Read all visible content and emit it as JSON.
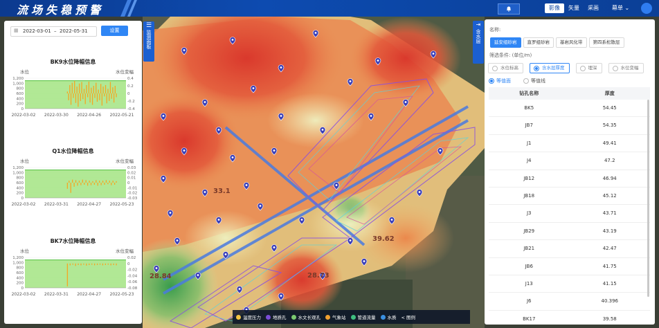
{
  "app": {
    "title": "流场失稳预警"
  },
  "header": {
    "bell_icon": "bell-icon",
    "map_types": [
      "影像",
      "矢量",
      "采画"
    ],
    "active_map_type": "影像",
    "menu_label": "幕单",
    "avatar_icon": "user-avatar-icon"
  },
  "left_panel": {
    "date_start": "2022-03-01",
    "date_sep": "–",
    "date_end": "2022-05-31",
    "set_button": "设置",
    "charts": [
      {
        "title": "BK9水位降幅信息",
        "left_label": "水位",
        "right_label": "水位变幅",
        "left_ticks": [
          "1,200",
          "1,000",
          "800",
          "600",
          "400",
          "200",
          "0"
        ],
        "right_ticks": [
          "0.4",
          "0.2",
          "0",
          "-0.2",
          "-0.4"
        ],
        "x_ticks": [
          "2022-03-02",
          "2022-03-30",
          "2022-04-26",
          "2022-05-21"
        ],
        "water_level": 1100,
        "bars": [
          0.05,
          -0.18,
          0.22,
          -0.3,
          0.28,
          -0.12,
          0.33,
          -0.25,
          0.18,
          -0.35,
          0.26,
          -0.2,
          0.3,
          -0.15,
          0.12,
          -0.28,
          0.22,
          -0.1,
          0.31,
          -0.24,
          0.15,
          -0.3,
          0.2,
          -0.12,
          0.28,
          -0.22,
          0.1,
          -0.18,
          0.25,
          -0.32,
          0.18,
          -0.08,
          0.22,
          -0.26,
          0.12,
          -0.2,
          0.3,
          -0.14,
          0.16,
          -0.24,
          0.2,
          -0.1
        ]
      },
      {
        "title": "Q1水位降幅信息",
        "left_label": "水位",
        "right_label": "水位变幅",
        "left_ticks": [
          "1,200",
          "1,000",
          "800",
          "600",
          "400",
          "200",
          "0"
        ],
        "right_ticks": [
          "0.03",
          "0.02",
          "0.01",
          "0",
          "-0.01",
          "-0.02",
          "-0.03"
        ],
        "x_ticks": [
          "2022-03-02",
          "2022-03-31",
          "2022-04-27",
          "2022-05-23"
        ],
        "water_level": 1100,
        "bars": [
          -0.012,
          0.004,
          -0.02,
          0.006,
          -0.008,
          0.005,
          -0.006,
          0.004,
          -0.005,
          0.006,
          -0.004,
          0.005,
          -0.006,
          0.004,
          -0.005,
          0.003,
          -0.004,
          0.005,
          -0.006,
          0.004,
          -0.005,
          0.004,
          -0.004,
          0.005,
          -0.003,
          0.004,
          -0.005,
          0.004,
          -0.004,
          0.003
        ]
      },
      {
        "title": "BK7水位降幅信息",
        "left_label": "水位",
        "right_label": "水位变幅",
        "left_ticks": [
          "1,200",
          "1,000",
          "800",
          "600",
          "400",
          "200",
          "0"
        ],
        "right_ticks": [
          "0.02",
          "0",
          "-0.02",
          "-0.04",
          "-0.06",
          "-0.08"
        ],
        "x_ticks": [
          "2022-03-02",
          "2022-03-31",
          "2022-04-27",
          "2022-05-23"
        ],
        "water_level": 1100,
        "bars": [
          -0.075,
          -0.006,
          -0.004,
          -0.008,
          -0.005,
          -0.006,
          -0.004,
          -0.007,
          -0.005,
          -0.004,
          -0.006,
          -0.005,
          -0.004,
          -0.006,
          -0.005,
          -0.004,
          -0.006,
          -0.005,
          -0.006
        ]
      }
    ]
  },
  "side_tabs": {
    "monitor_panel": "监测面板",
    "aquifer": "含水层"
  },
  "right_panel": {
    "name_label": "名称:",
    "tabs": [
      "延安组砂岩",
      "直罗组砂岩",
      "基岩风化带",
      "第四系松散层"
    ],
    "active_tab": "延安组砂岩",
    "filter_label": "筛选条件: (单位/m)",
    "filters": [
      "水位标高",
      "含水层厚度",
      "埋深",
      "水位变幅"
    ],
    "active_filter": "含水层厚度",
    "modes": [
      "等值面",
      "等值线"
    ],
    "active_mode": "等值面",
    "table": {
      "headers": [
        "钻孔名称",
        "厚度"
      ],
      "rows": [
        [
          "BK5",
          "54.45"
        ],
        [
          "JB7",
          "54.35"
        ],
        [
          "J1",
          "49.41"
        ],
        [
          "J4",
          "47.2"
        ],
        [
          "JB12",
          "46.94"
        ],
        [
          "JB18",
          "45.12"
        ],
        [
          "J3",
          "43.71"
        ],
        [
          "JB29",
          "43.19"
        ],
        [
          "JB21",
          "42.47"
        ],
        [
          "JB6",
          "41.75"
        ],
        [
          "J13",
          "41.15"
        ],
        [
          "J6",
          "40.396"
        ],
        [
          "BK17",
          "39.58"
        ]
      ]
    }
  },
  "map": {
    "labels": [
      {
        "text": "33.1"
      },
      {
        "text": "39.62"
      },
      {
        "text": "28.73"
      },
      {
        "text": "28.84"
      }
    ],
    "legend": [
      {
        "label": "温度压力",
        "color": "#f5c542"
      },
      {
        "label": "地质孔",
        "color": "#7b4dd6"
      },
      {
        "label": "水文长观孔",
        "color": "#7bc96f"
      },
      {
        "label": "气象站",
        "color": "#f0a030"
      },
      {
        "label": "管道流量",
        "color": "#3fbf7f"
      },
      {
        "label": "水质",
        "color": "#3a8fe0"
      }
    ],
    "legend_toggle": "< 图例"
  }
}
